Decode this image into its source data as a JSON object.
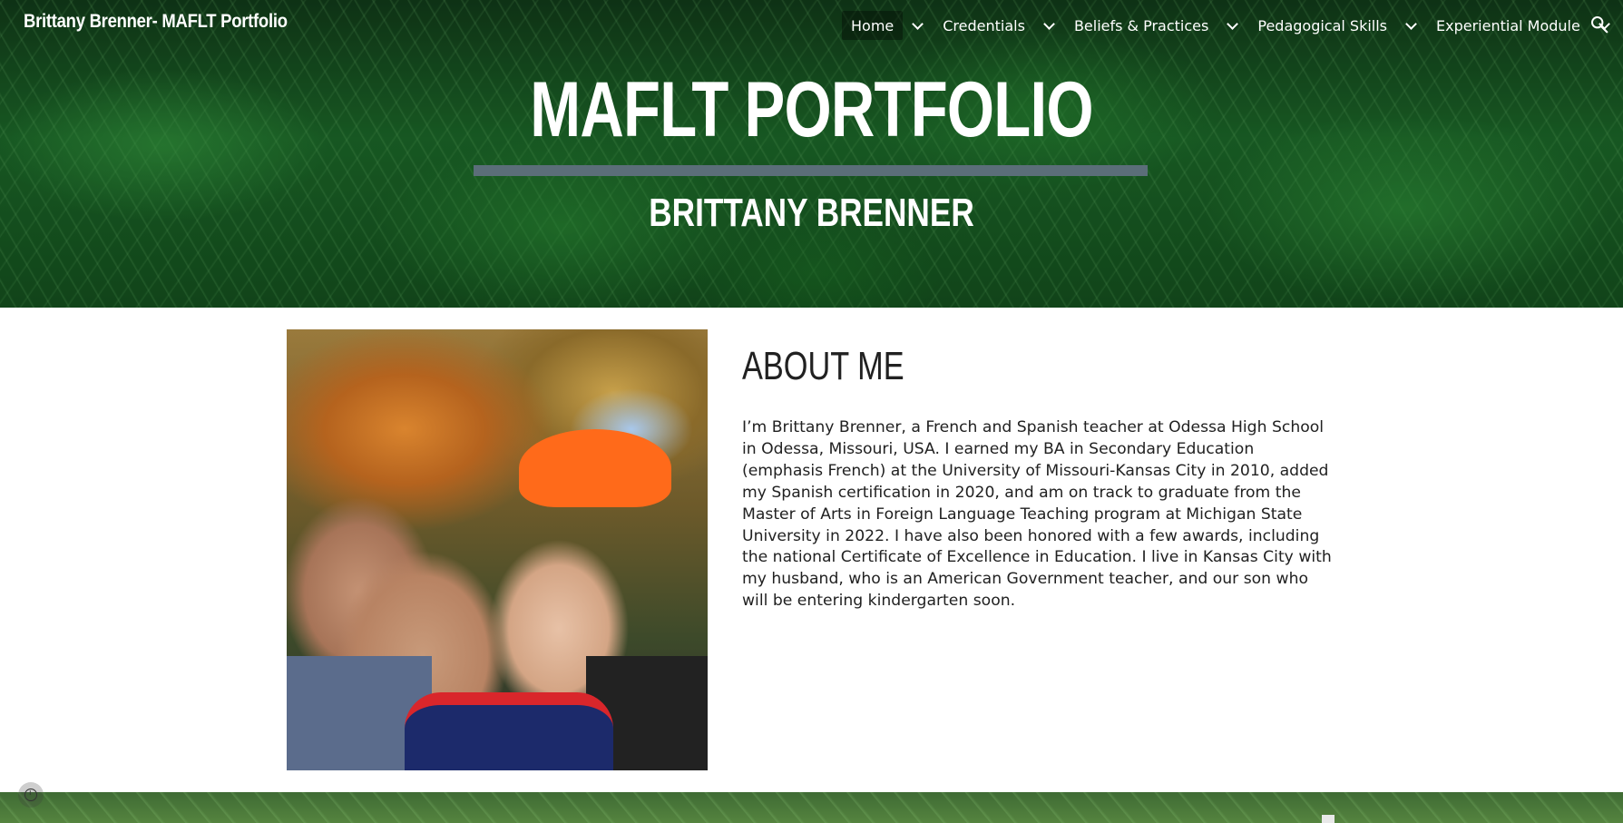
{
  "site": {
    "title": "Brittany Brenner- MAFLT Portfolio"
  },
  "nav": {
    "items": [
      {
        "label": "Home",
        "active": true,
        "has_dropdown": true
      },
      {
        "label": "Credentials",
        "active": false,
        "has_dropdown": true
      },
      {
        "label": "Beliefs & Practices",
        "active": false,
        "has_dropdown": true
      },
      {
        "label": "Pedagogical Skills",
        "active": false,
        "has_dropdown": true
      },
      {
        "label": "Experiential Module",
        "active": false,
        "has_dropdown": true
      }
    ],
    "search_icon": "search-icon",
    "dropdown_icon": "chevron-down-icon"
  },
  "hero": {
    "title": "MAFLT PORTFOLIO",
    "subtitle": "BRITTANY BRENNER",
    "rule_color": "#5b6e79"
  },
  "about": {
    "heading": "ABOUT ME",
    "body": "I’m Brittany Brenner, a French and Spanish teacher at Odessa High School in Odessa, Missouri, USA. I earned my BA in Secondary Education (emphasis French) at the University of Missouri-Kansas City in 2010, added my Spanish certification in 2020, and am on track to graduate from the Master of Arts in Foreign Language Teaching program at Michigan State University in 2022. I have also been honored with a few awards, including the national Certificate of Excellence in Education. I live in Kansas City with my husband, who is an American Government teacher, and our son who will be entering kindergarten soon."
  },
  "footer": {
    "info_icon": "info-icon"
  },
  "colors": {
    "text": "#212121",
    "hero_overlay_text": "#ffffff"
  }
}
